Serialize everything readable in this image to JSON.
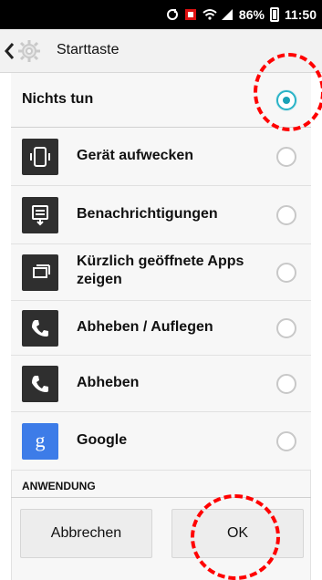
{
  "status_bar": {
    "battery_percent": "86%",
    "time": "11:50"
  },
  "app_bar": {
    "title": "Starttaste"
  },
  "options": [
    {
      "label": "Nichts tun",
      "selected": true
    },
    {
      "label": "Gerät aufwecken",
      "selected": false,
      "icon": "wake-device-icon"
    },
    {
      "label": "Benachrichtigungen",
      "selected": false,
      "icon": "notifications-icon"
    },
    {
      "label": "Kürzlich geöffnete Apps zeigen",
      "selected": false,
      "icon": "recent-apps-icon"
    },
    {
      "label": "Abheben / Auflegen",
      "selected": false,
      "icon": "phone-icon"
    },
    {
      "label": "Abheben",
      "selected": false,
      "icon": "phone-icon"
    },
    {
      "label": "Google",
      "selected": false,
      "icon": "google-icon"
    }
  ],
  "section": {
    "title": "ANWENDUNG"
  },
  "buttons": {
    "cancel": "Abbrechen",
    "ok": "OK"
  },
  "annotation": {
    "color": "#ff0000"
  }
}
